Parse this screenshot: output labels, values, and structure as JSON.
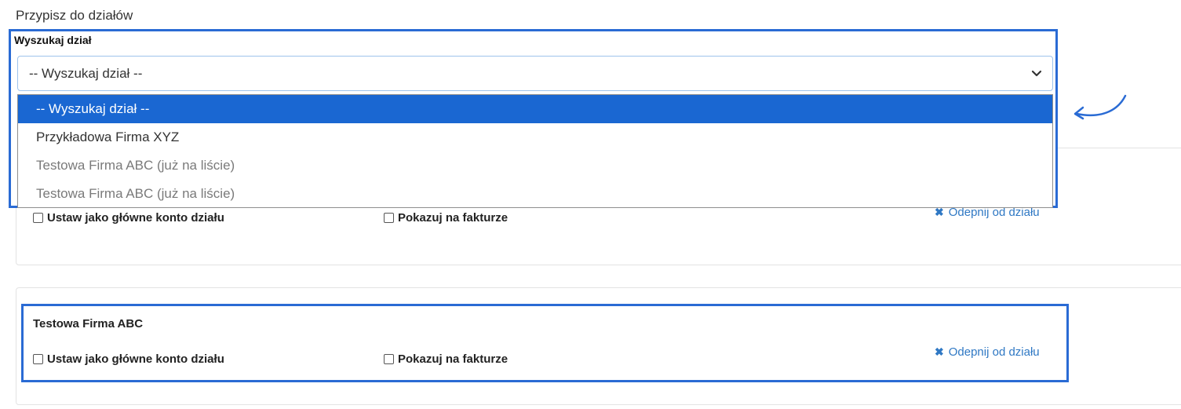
{
  "section_title": "Przypisz do działów",
  "search": {
    "label": "Wyszukaj dział",
    "selected_value": "-- Wyszukaj dział --",
    "options": [
      {
        "label": "-- Wyszukaj dział --",
        "state": "selected"
      },
      {
        "label": "Przykładowa Firma XYZ",
        "state": "normal"
      },
      {
        "label": "Testowa Firma ABC (już na liście)",
        "state": "disabled"
      },
      {
        "label": "Testowa Firma ABC (już na liście)",
        "state": "disabled"
      }
    ]
  },
  "cards": [
    {
      "title": "",
      "primary_account_label": "Ustaw jako główne konto działu",
      "show_on_invoice_label": "Pokazuj na fakturze",
      "unlink_label": "Odepnij od działu"
    },
    {
      "title": "Testowa Firma ABC",
      "primary_account_label": "Ustaw jako główne konto działu",
      "show_on_invoice_label": "Pokazuj na fakturze",
      "unlink_label": "Odepnij od działu"
    }
  ],
  "colors": {
    "highlight": "#2a6bd4",
    "selected_option": "#1a67d2",
    "link": "#2f78c4"
  },
  "icons": {
    "unlink": "close-icon",
    "select": "chevron-down-icon",
    "annotation": "curved-arrow-icon"
  }
}
